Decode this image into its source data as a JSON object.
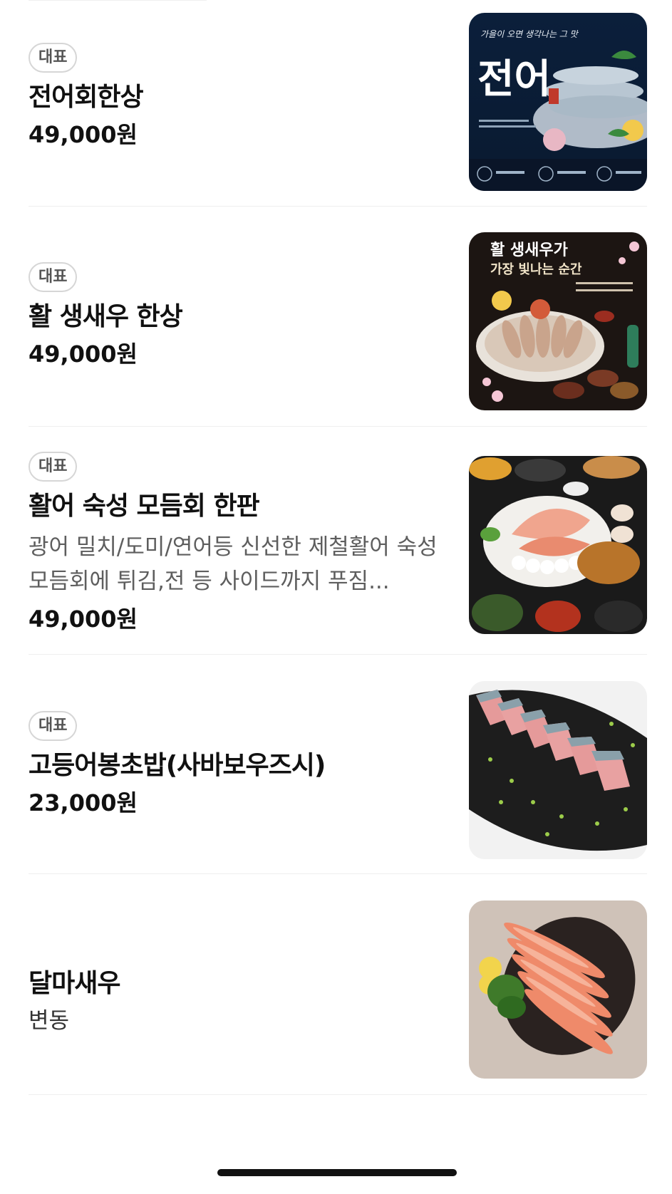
{
  "menu": {
    "items": [
      {
        "badge": "대표",
        "name": "전어회한상",
        "description": "",
        "price": "49,000원",
        "image_icon": "jeoneo-fish-photo-icon",
        "image_text": {
          "title": "전어",
          "tagline": "가을이 오면 생각나는 그 맛"
        }
      },
      {
        "badge": "대표",
        "name": "활 생새우 한상",
        "description": "",
        "price": "49,000원",
        "image_icon": "live-shrimp-photo-icon",
        "image_text": {
          "title": "활 생새우가",
          "tagline": "가장 빛나는 순간"
        }
      },
      {
        "badge": "대표",
        "name": "활어 숙성 모듬회 한판",
        "description": "광어 밀치/도미/연어등 신선한 제철활어 숙성모듬회에 튀김,전 등 사이드까지 푸짐...",
        "price": "49,000원",
        "image_icon": "sashimi-platter-photo-icon"
      },
      {
        "badge": "대표",
        "name": "고등어봉초밥(사바보우즈시)",
        "description": "",
        "price": "23,000원",
        "image_icon": "mackerel-sushi-photo-icon"
      },
      {
        "badge": "",
        "name": "달마새우",
        "description": "",
        "price": "변동",
        "image_icon": "dalma-shrimp-photo-icon"
      }
    ]
  },
  "colors": {
    "badge_border": "#d6d6d6",
    "badge_text": "#555555",
    "description_text": "#5e5e5e",
    "divider": "#efefef"
  }
}
